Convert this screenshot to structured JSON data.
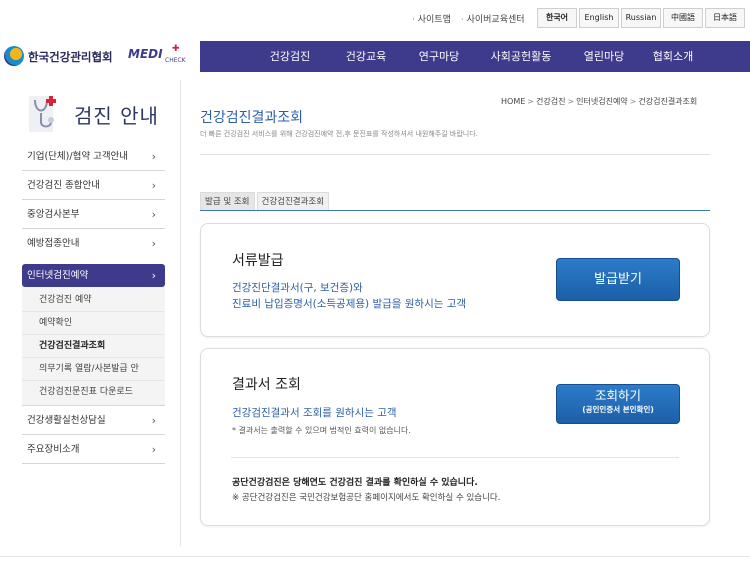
{
  "top": {
    "links": [
      "사이트맵",
      "사이버교육센터"
    ],
    "languages": [
      "한국어",
      "English",
      "Russian",
      "中國語",
      "日本語"
    ],
    "active_language": "한국어"
  },
  "brand": {
    "name": "한국건강관리협회",
    "sub_logo": "MEDI",
    "sub_logo_small": "CHECK"
  },
  "nav": {
    "items": [
      "건강검진",
      "건강교육",
      "연구마당",
      "사회공헌활동",
      "열린마당",
      "협회소개"
    ]
  },
  "sidebar": {
    "title": "검진 안내",
    "items": [
      {
        "label": "기업(단체)/협약 고객안내"
      },
      {
        "label": "건강검진 종합안내"
      },
      {
        "label": "중앙검사본부"
      },
      {
        "label": "예방접종안내"
      },
      {
        "label": "인터넷검진예약"
      },
      {
        "label": "건강생활실천상담실"
      },
      {
        "label": "주요장비소개"
      }
    ],
    "sub_items": [
      "건강검진 예약",
      "예약확인",
      "건강검진결과조회",
      "의무기록 열람/사본발급 안",
      "건강검진문진표 다운로드"
    ],
    "chevron": "›"
  },
  "breadcrumb": [
    "HOME",
    "건강검진",
    "인터넷검진예약",
    "건강검진결과조회"
  ],
  "page": {
    "title": "건강검진결과조회",
    "description": "더 빠른 건강검진 서비스를 위해 건강검진예약 전,후 문진표를 작성하셔서 내원해주길 바랍니다."
  },
  "tabs": [
    "발급 및 조회",
    "건강검진결과조회"
  ],
  "card1": {
    "heading": "서류발급",
    "line1": "건강진단결과서(구, 보건증)와",
    "line2": "진료비 납입증명서(소득공제용) 발급을 원하시는 고객",
    "button": "발급받기"
  },
  "card2": {
    "heading": "결과서 조회",
    "line1": "건강검진결과서 조회를 원하시는 고객",
    "note": "* 결과서는 출력할 수 있으며 법적인 효력이 없습니다.",
    "button_main": "조회하기",
    "button_sub": "(공인인증서 본인확인)",
    "bold_text": "공단건강검진은 당해연도 건강검진 결과를 확인하실 수 있습니다.",
    "note2": "※ 공단건강검진은 국민건강보험공단 홈페이지에서도 확인하실 수 있습니다."
  },
  "colors": {
    "nav_bg": "#3e3a8c",
    "title_blue": "#2e5ea8",
    "button_blue": "#1c5fa8"
  }
}
